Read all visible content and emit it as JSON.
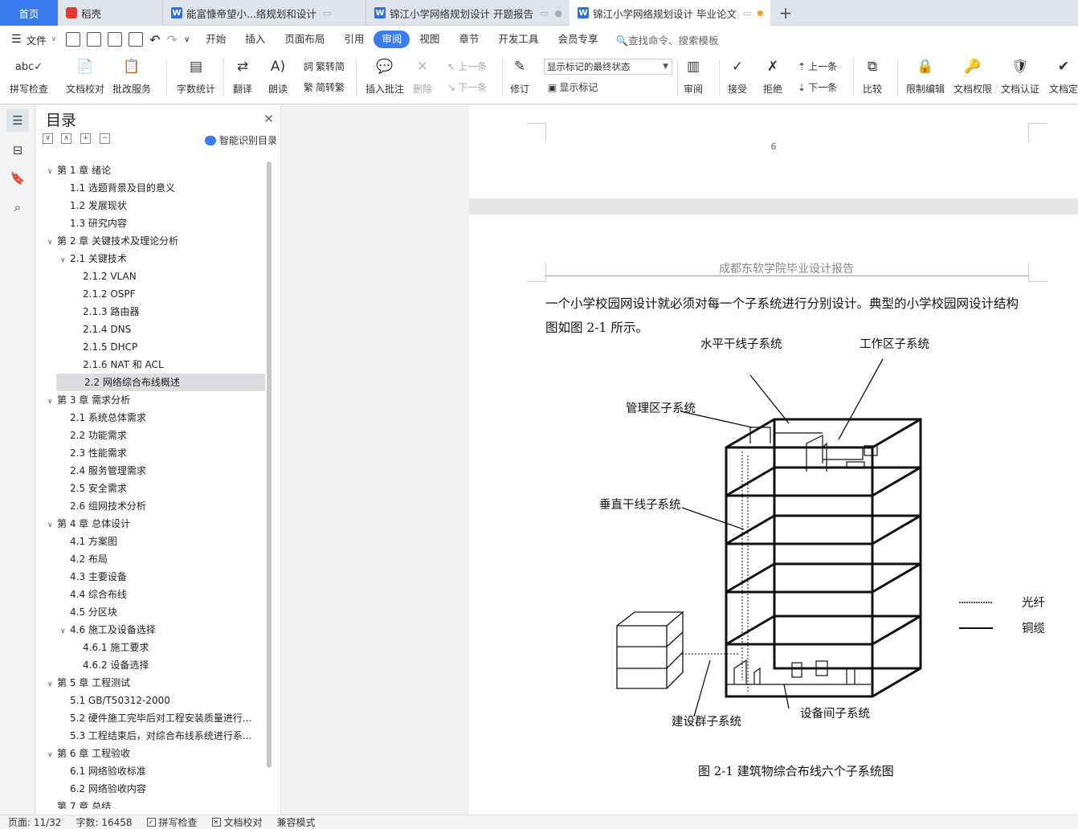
{
  "tabs": {
    "home": "首页",
    "daoke": "稻壳",
    "doc1": "能富慷帝望小...络规划和设计",
    "doc2": "锦江小学网络规划设计 开题报告",
    "doc3": "锦江小学网络规划设计 毕业论文",
    "new_tab": "+"
  },
  "menubar": {
    "file": "文件",
    "items": [
      "开始",
      "插入",
      "页面布局",
      "引用",
      "审阅",
      "视图",
      "章节",
      "开发工具",
      "会员专享"
    ],
    "active": "审阅",
    "search": "查找命令、搜索模板"
  },
  "ribbon": {
    "spellcheck": "拼写检查",
    "doc_proof": "文档校对",
    "batch_service": "批改服务",
    "word_count": "字数统计",
    "translate": "翻译",
    "read_aloud": "朗读",
    "trad_to_simp": "繁转简",
    "simp_to_trad": "简转繁",
    "insert_comment": "插入批注",
    "delete": "删除",
    "prev_comment": "上一条",
    "next_comment": "下一条",
    "track_changes": "修订",
    "mark_state": "显示标记的最终状态",
    "show_markup": "显示标记",
    "review": "审阅",
    "accept": "接受",
    "reject": "拒绝",
    "prev": "上一条",
    "next": "下一条",
    "compare": "比较",
    "restrict_edit": "限制编辑",
    "doc_permission": "文档权限",
    "doc_auth": "文档认证",
    "doc_final": "文档定"
  },
  "toc": {
    "title": "目录",
    "smart": "智能识别目录",
    "items": [
      {
        "text": "第 1 章  绪论",
        "level": 1,
        "arrow": "open"
      },
      {
        "text": "1.1  选题背景及目的意义",
        "level": 2
      },
      {
        "text": "1.2  发展现状",
        "level": 2
      },
      {
        "text": "1.3  研究内容",
        "level": 2
      },
      {
        "text": "第 2 章  关键技术及理论分析",
        "level": 1,
        "arrow": "open"
      },
      {
        "text": "2.1  关键技术",
        "level": 2,
        "arrow": "open"
      },
      {
        "text": "2.1.2 VLAN",
        "level": 3
      },
      {
        "text": "2.1.2 OSPF",
        "level": 3
      },
      {
        "text": "2.1.3  路由器",
        "level": 3
      },
      {
        "text": "2.1.4 DNS",
        "level": 3
      },
      {
        "text": "2.1.5 DHCP",
        "level": 3
      },
      {
        "text": "2.1.6 NAT 和 ACL",
        "level": 3
      },
      {
        "text": "2.2  网络综合布线概述",
        "level": 2,
        "selected": true
      },
      {
        "text": "第 3 章  需求分析",
        "level": 1,
        "arrow": "open"
      },
      {
        "text": "2.1  系统总体需求",
        "level": 2
      },
      {
        "text": "2.2  功能需求",
        "level": 2
      },
      {
        "text": "2.3  性能需求",
        "level": 2
      },
      {
        "text": "2.4  服务管理需求",
        "level": 2
      },
      {
        "text": "2.5  安全需求",
        "level": 2
      },
      {
        "text": "2.6  组网技术分析",
        "level": 2
      },
      {
        "text": "第 4 章  总体设计",
        "level": 1,
        "arrow": "open"
      },
      {
        "text": "4.1  方案图",
        "level": 2
      },
      {
        "text": "4.2  布局",
        "level": 2
      },
      {
        "text": "4.3  主要设备",
        "level": 2
      },
      {
        "text": "4.4  综合布线",
        "level": 2
      },
      {
        "text": "4.5  分区块",
        "level": 2
      },
      {
        "text": "4.6  施工及设备选择",
        "level": 2,
        "arrow": "open"
      },
      {
        "text": "4.6.1  施工要求",
        "level": 3
      },
      {
        "text": "4.6.2  设备选择",
        "level": 3
      },
      {
        "text": "第 5 章  工程测试",
        "level": 1,
        "arrow": "open"
      },
      {
        "text": "5.1 GB/T50312-2000",
        "level": 2
      },
      {
        "text": "5.2  硬件施工完毕后对工程安装质量进行...",
        "level": 2
      },
      {
        "text": "5.3  工程结束后，对综合布线系统进行系...",
        "level": 2
      },
      {
        "text": "第 6 章  工程验收",
        "level": 1,
        "arrow": "open"
      },
      {
        "text": "6.1  网络验收标准",
        "level": 2
      },
      {
        "text": "6.2  网络验收内容",
        "level": 2
      },
      {
        "text": "第 7 章  总结",
        "level": 1
      }
    ]
  },
  "document": {
    "prev_page_number": "6",
    "header": "成都东软学院毕业设计报告",
    "body_line1": "一个小学校园网设计就必须对每一个子系统进行分别设计。典型的小学校园网设计结构",
    "body_line2": "图如图 2-1 所示。",
    "figure_labels": {
      "horizontal": "水平干线子系统",
      "work_area": "工作区子系统",
      "management": "管理区子系统",
      "vertical": "垂直干线子系统",
      "campus": "建设群子系统",
      "equipment_room": "设备间子系统",
      "legend_fiber": "光纤",
      "legend_copper": "铜缆"
    },
    "caption": "图 2-1 建筑物综合布线六个子系统图"
  },
  "status": {
    "page": "页面: 11/32",
    "words": "字数: 16458",
    "spell": "拼写检查",
    "proof": "文档校对",
    "compat": "兼容模式"
  },
  "colors": {
    "accent": "#3a7bf0",
    "tab_bar": "#dfe3ea",
    "selection": "#dcdde1"
  }
}
